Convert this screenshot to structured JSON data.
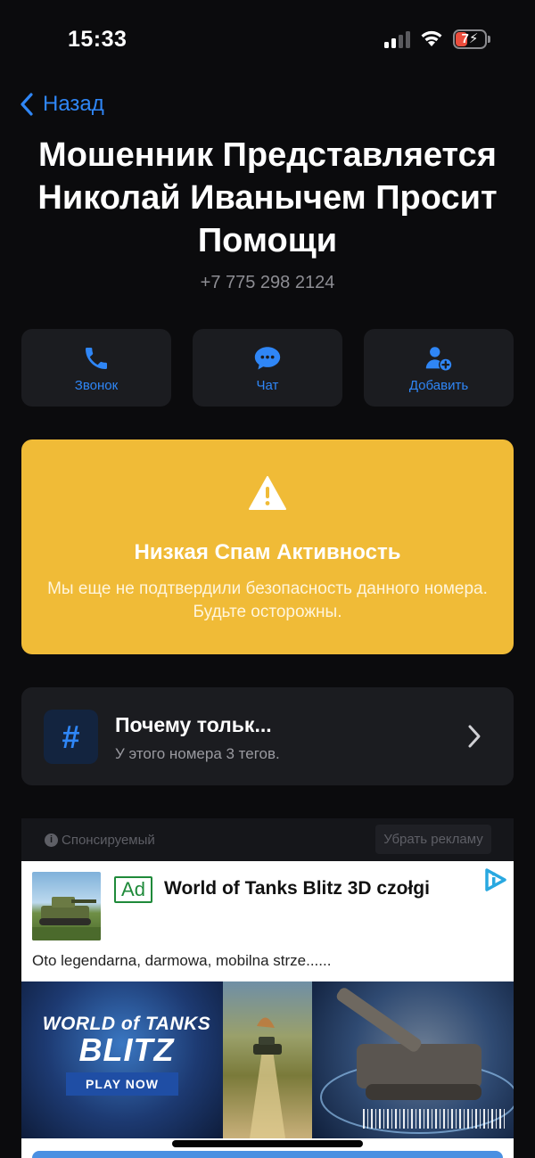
{
  "status_bar": {
    "time": "15:33",
    "battery": "7"
  },
  "nav": {
    "back_label": "Назад"
  },
  "contact": {
    "title": "Мошенник Представляется Николай Иванычем Просит Помощи",
    "phone": "+7 775 298 2124"
  },
  "actions": [
    {
      "label": "Звонок",
      "icon": "phone-icon"
    },
    {
      "label": "Чат",
      "icon": "chat-icon"
    },
    {
      "label": "Добавить",
      "icon": "add-contact-icon"
    }
  ],
  "spam_card": {
    "title": "Низкая Спам Активность",
    "text": "Мы еще не подтвердили безопасность данного номера. Будьте осторожны.",
    "color": "#f0bb37"
  },
  "tags_card": {
    "title": "Почему тольк...",
    "subtitle": "У этого номера 3 тегов."
  },
  "sponsored": {
    "label": "Спонсируемый",
    "remove_ads": "Убрать рекламу",
    "ad": {
      "badge": "Ad",
      "title": "World of Tanks Blitz 3D czołgi",
      "description": "Oto legendarna, darmowa, mobilna strze......",
      "banner_line1": "WORLD of TANKS",
      "banner_line2": "BLITZ",
      "cta": "PLAY NOW"
    }
  },
  "colors": {
    "accent": "#2f86f6",
    "background": "#0b0b0d",
    "card": "#1b1c20"
  }
}
